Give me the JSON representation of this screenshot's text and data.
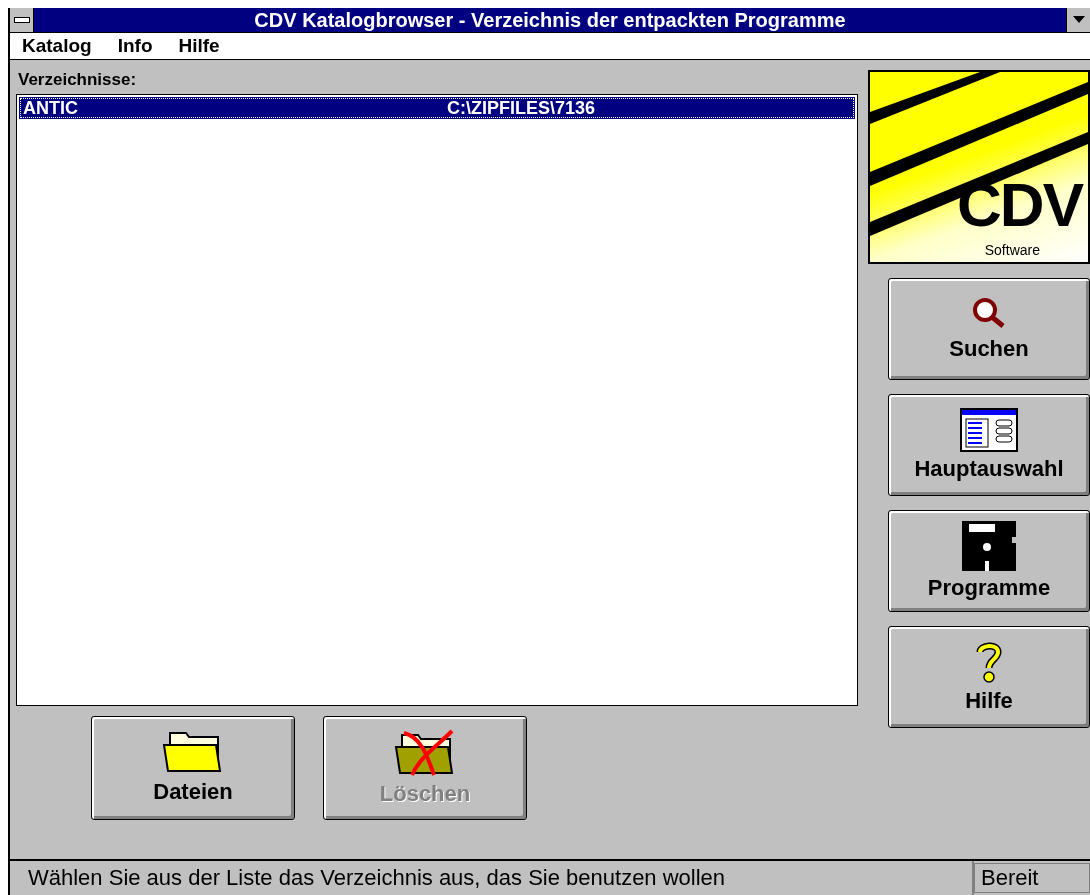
{
  "window": {
    "title": "CDV Katalogbrowser - Verzeichnis der entpackten Programme"
  },
  "menu": [
    "Katalog",
    "Info",
    "Hilfe"
  ],
  "list": {
    "label": "Verzeichnisse:",
    "rows": [
      {
        "name": "ANTIC",
        "path": "C:\\ZIPFILES\\7136",
        "selected": true
      }
    ]
  },
  "logo": {
    "mark": "CDV",
    "caption": "Software"
  },
  "side_buttons": [
    {
      "kind": "search",
      "label": "Suchen"
    },
    {
      "kind": "main",
      "label": "Hauptauswahl"
    },
    {
      "kind": "disk",
      "label": "Programme"
    },
    {
      "kind": "help",
      "label": "Hilfe"
    }
  ],
  "bottom_buttons": [
    {
      "kind": "folder",
      "label": "Dateien",
      "disabled": false
    },
    {
      "kind": "delete",
      "label": "Löschen",
      "disabled": true
    }
  ],
  "status_bar": {
    "message": "Wählen Sie aus der Liste das Verzeichnis aus, das Sie benutzen wollen",
    "state": "Bereit"
  }
}
